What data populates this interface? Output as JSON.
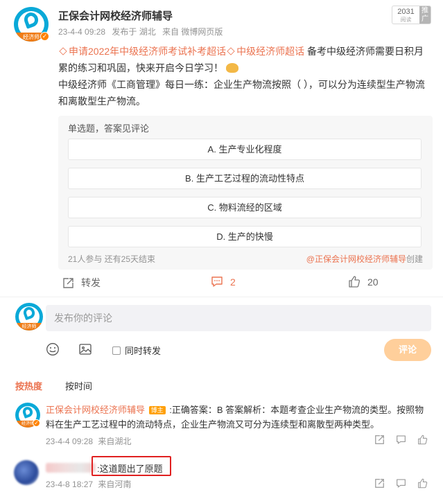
{
  "post": {
    "author": "正保会计网校经济师辅导",
    "avatar_tag": "经济师",
    "verified_icon": "verified-icon",
    "time": "23-4-4 09:28",
    "posted_from": "发布于 湖北",
    "source": "来自 微博网页版",
    "read_count": "2031",
    "read_label": "阅读",
    "promote_label": "推广",
    "topic1": "申请2022年中级经济师考试补考超话",
    "topic2": "中级经济师超话",
    "text1": " 备考中级经济师需要日积月累的练习和巩固，快来开启今日学习！",
    "text2": "中级经济师《工商管理》每日一练：企业生产物流按照（    ），可以分为连续型生产物流和离散型生产物流。"
  },
  "poll": {
    "type": "单选题，答案见评论",
    "options": [
      "A. 生产专业化程度",
      "B. 生产工艺过程的流动性特点",
      "C. 物料流经的区域",
      "D. 生产的快慢"
    ],
    "stats": "21人参与 还有25天结束",
    "creator": "@正保会计网校经济师辅导",
    "creator_suffix": "创建"
  },
  "actions": {
    "repost": "转发",
    "comment_count": "2",
    "like_count": "20"
  },
  "composer": {
    "placeholder": "发布你的评论",
    "repost_label": "同时转发",
    "submit": "评论"
  },
  "sort": {
    "hot": "按热度",
    "time": "按时间"
  },
  "comments": [
    {
      "author": "正保会计网校经济师辅导",
      "badge": "博主",
      "text": ":正确答案：B 答案解析：本题考查企业生产物流的类型。按照物料在生产工艺过程中的流动特点，企业生产物流又可分为连续型和离散型两种类型。",
      "time": "23-4-4 09:28",
      "location": "来自湖北"
    },
    {
      "text": ":这道题出了原题",
      "time": "23-4-8 18:27",
      "location": "来自河南"
    }
  ],
  "colors": {
    "accent": "#eb7350",
    "brand_blue": "#0aa9d8",
    "submit_disabled": "#ffcf9b",
    "highlight_box": "#e02020"
  }
}
